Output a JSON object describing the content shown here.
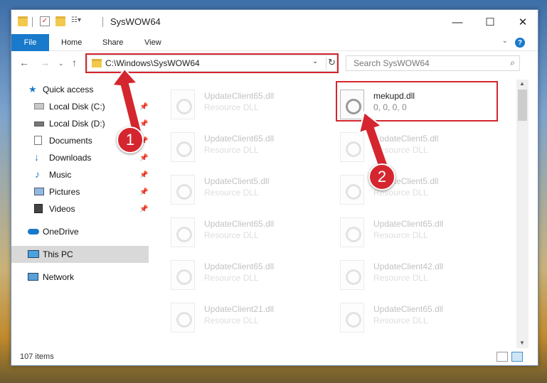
{
  "window": {
    "title": "SysWOW64",
    "minimize": "—",
    "maximize": "☐",
    "close": "✕"
  },
  "ribbon": {
    "tabs": [
      "File",
      "Home",
      "Share",
      "View"
    ],
    "help": "?"
  },
  "address": {
    "path": "C:\\Windows\\SysWOW64",
    "refresh_icon": "↻",
    "dropdown_icon": "⌄"
  },
  "search": {
    "placeholder": "Search SysWOW64"
  },
  "sidebar": {
    "items": [
      {
        "label": "Quick access",
        "icon": "star-icon"
      },
      {
        "label": "Local Disk (C:)",
        "icon": "drive-icon"
      },
      {
        "label": "Local Disk (D:)",
        "icon": "drive-icon"
      },
      {
        "label": "Documents",
        "icon": "documents-icon"
      },
      {
        "label": "Downloads",
        "icon": "download-icon"
      },
      {
        "label": "Music",
        "icon": "music-icon"
      },
      {
        "label": "Pictures",
        "icon": "pictures-icon"
      },
      {
        "label": "Videos",
        "icon": "videos-icon"
      },
      {
        "label": "OneDrive",
        "icon": "cloud-icon"
      },
      {
        "label": "This PC",
        "icon": "pc-icon"
      },
      {
        "label": "Network",
        "icon": "network-icon"
      }
    ]
  },
  "files": {
    "left": [
      {
        "name": "UpdateClient65.dll",
        "type": "Resource DLL"
      },
      {
        "name": "UpdateClient65.dll",
        "type": "Resource DLL"
      },
      {
        "name": "UpdateClient5.dll",
        "type": "Resource DLL"
      },
      {
        "name": "UpdateClient65.dll",
        "type": "Resource DLL"
      },
      {
        "name": "UpdateClient65.dll",
        "type": "Resource DLL"
      },
      {
        "name": "UpdateClient21.dll",
        "type": "Resource DLL"
      }
    ],
    "right": [
      {
        "name": "mekupd.dll",
        "type": "0, 0, 0, 0"
      },
      {
        "name": "UpdateClient5.dll",
        "type": "Resource DLL"
      },
      {
        "name": "UpdateClient5.dll",
        "type": "Resource DLL"
      },
      {
        "name": "UpdateClient65.dll",
        "type": "Resource DLL"
      },
      {
        "name": "UpdateClient42.dll",
        "type": "Resource DLL"
      },
      {
        "name": "UpdateClient65.dll",
        "type": "Resource DLL"
      }
    ]
  },
  "status": {
    "count": "107 items"
  },
  "annotations": {
    "step1": "1",
    "step2": "2"
  },
  "colors": {
    "accent": "#1979ca",
    "highlight": "#d5262f"
  }
}
